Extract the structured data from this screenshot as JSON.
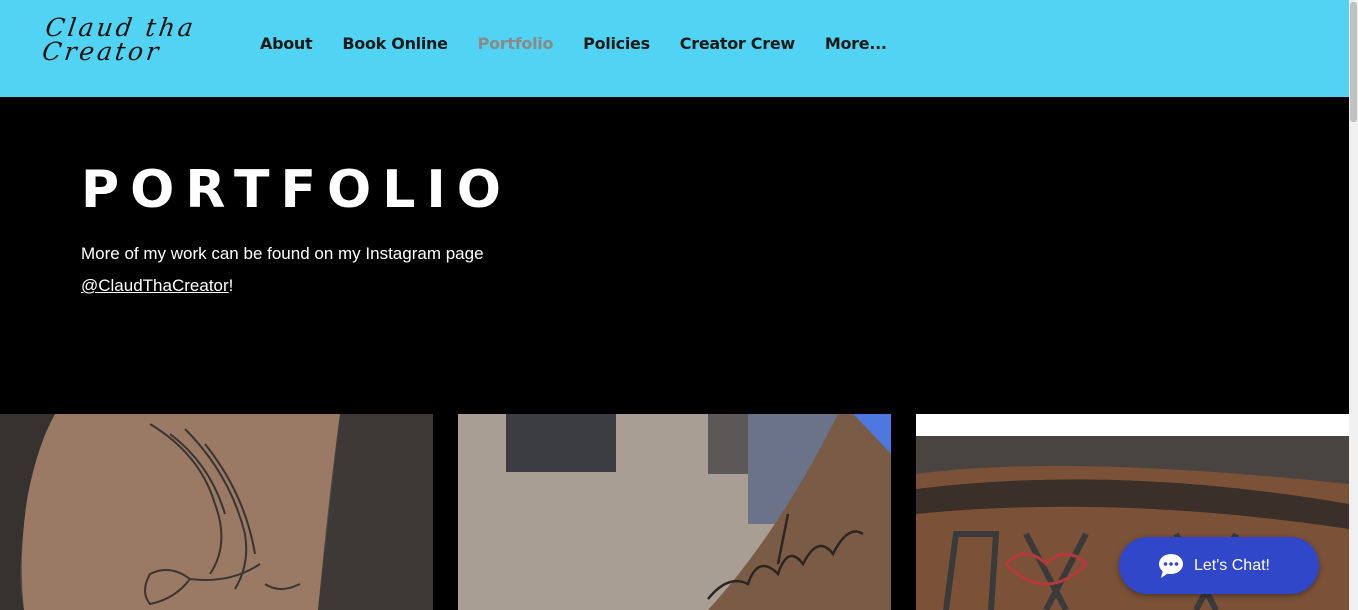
{
  "header": {
    "logo_line1": "Claud tha",
    "logo_line2": "Creator",
    "background": "#51d4f3",
    "nav": [
      {
        "label": "About",
        "active": false
      },
      {
        "label": "Book Online",
        "active": false
      },
      {
        "label": "Portfolio",
        "active": true
      },
      {
        "label": "Policies",
        "active": false
      },
      {
        "label": "Creator Crew",
        "active": false
      },
      {
        "label": "More...",
        "active": false
      }
    ]
  },
  "hero": {
    "title": "PORTFOLIO",
    "text": "More of my work can be found on my Instagram page",
    "instagram_link": "@ClaudThaCreator",
    "suffix": "!"
  },
  "gallery": {
    "tiles": [
      {
        "icon": "dove-tattoo-photo"
      },
      {
        "icon": "script-tattoo-photo"
      },
      {
        "icon": "lettering-tattoo-photo"
      }
    ]
  },
  "chat": {
    "label": "Let's Chat!",
    "icon": "chat-bubble-icon",
    "color": "#2f47c8"
  }
}
